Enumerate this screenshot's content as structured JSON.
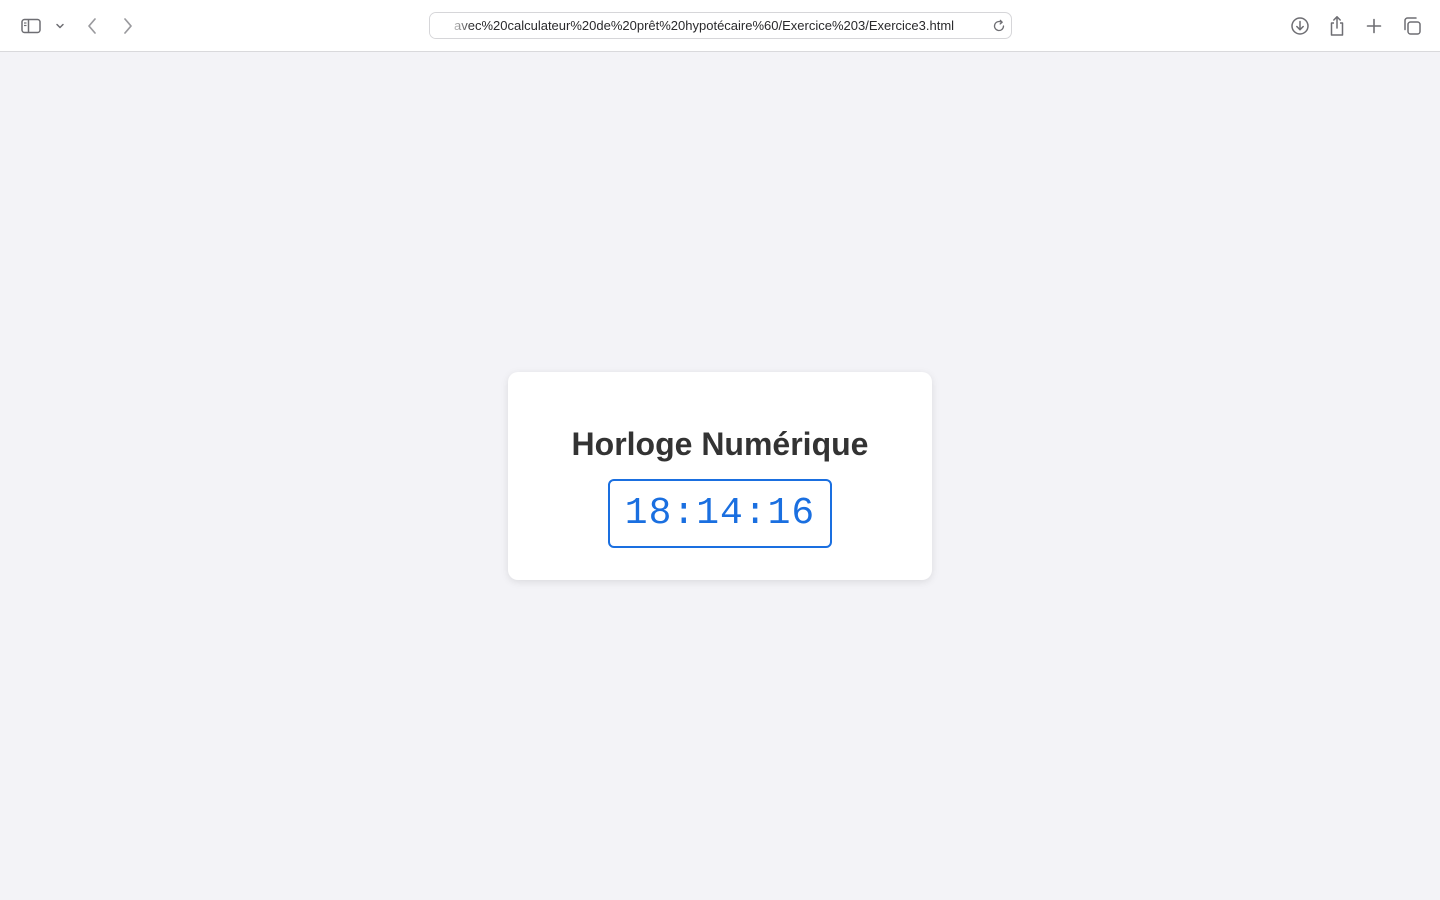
{
  "browser": {
    "url": "avec%20calculateur%20de%20prêt%20hypotécaire%60/Exercice%203/Exercice3.html",
    "icons": {
      "sidebar": "sidebar-icon",
      "sidebar_menu": "chevron-down-icon",
      "back": "chevron-left-icon",
      "forward": "chevron-right-icon",
      "reload": "reload-icon",
      "download": "download-icon",
      "share": "share-icon",
      "new_tab": "plus-icon",
      "tab_overview": "tabs-icon"
    }
  },
  "page": {
    "title": "Horloge Numérique",
    "clock_time": "18:14:16",
    "accent_color": "#1a6fe0",
    "background_color": "#f3f3f7"
  }
}
